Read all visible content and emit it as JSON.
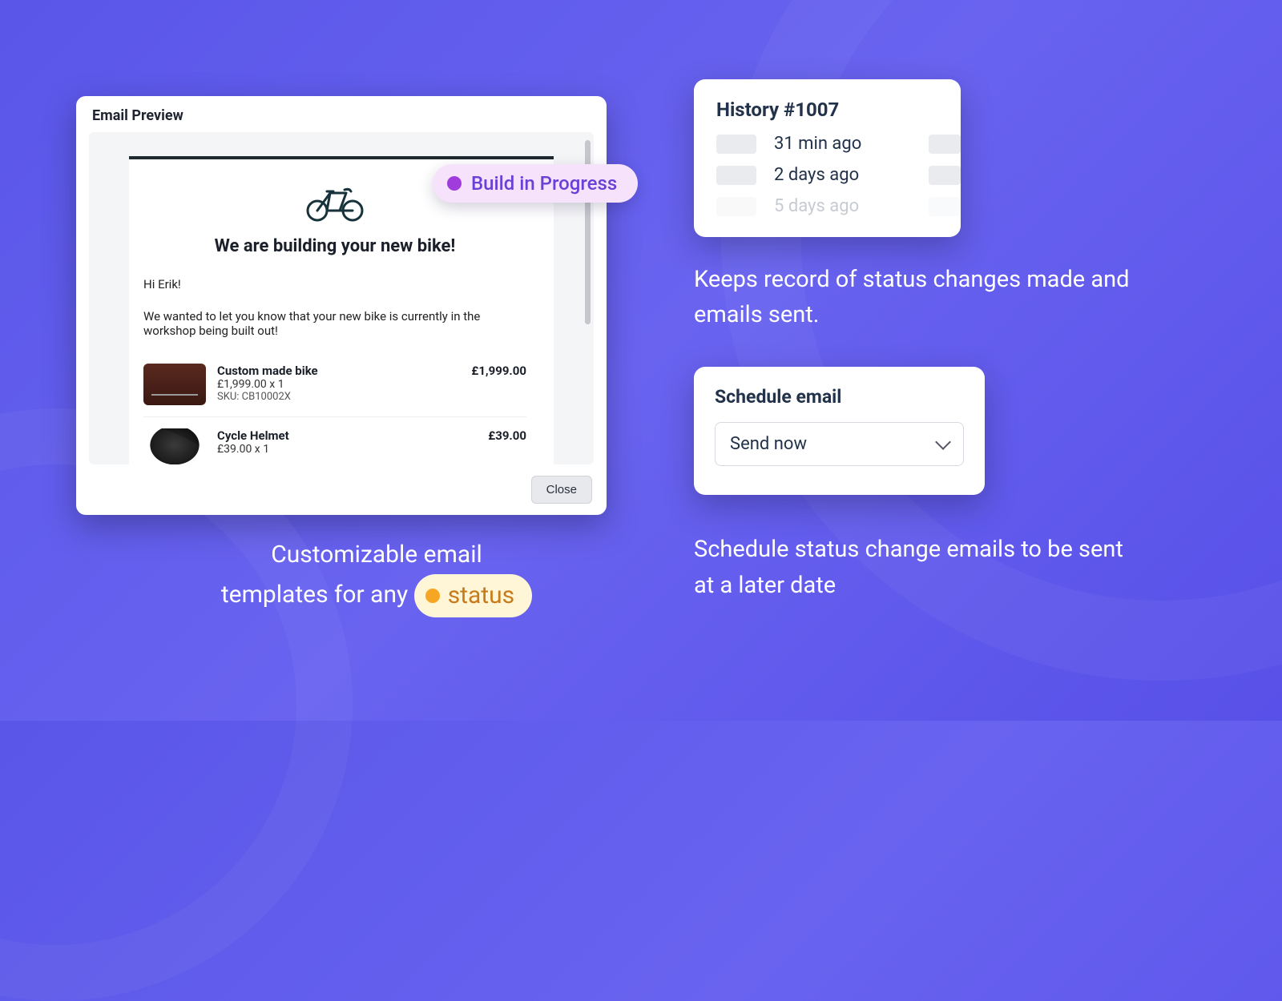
{
  "preview": {
    "header": "Email Preview",
    "headline": "We are building your new bike!",
    "greeting": "Hi Erik!",
    "body_text": "We wanted to let you know that your new bike is currently in the workshop being built out!",
    "close_label": "Close",
    "products": [
      {
        "name": "Custom made bike",
        "line": "£1,999.00 x 1",
        "sku": "SKU: CB10002X",
        "price": "£1,999.00"
      },
      {
        "name": "Cycle Helmet",
        "line": "£39.00 x 1",
        "sku": "",
        "price": "£39.00"
      }
    ]
  },
  "status_pill": {
    "label": "Build in Progress"
  },
  "left_caption": {
    "line1": "Customizable email",
    "line2_before": "templates for any",
    "chip_label": "status"
  },
  "history": {
    "title": "History #1007",
    "rows": [
      "31 min ago",
      "2 days ago",
      "5 days ago"
    ]
  },
  "right_caption_1": "Keeps record of status changes made and emails sent.",
  "schedule": {
    "title": "Schedule email",
    "selected": "Send now"
  },
  "right_caption_2": "Schedule status change emails to be sent at a later date"
}
